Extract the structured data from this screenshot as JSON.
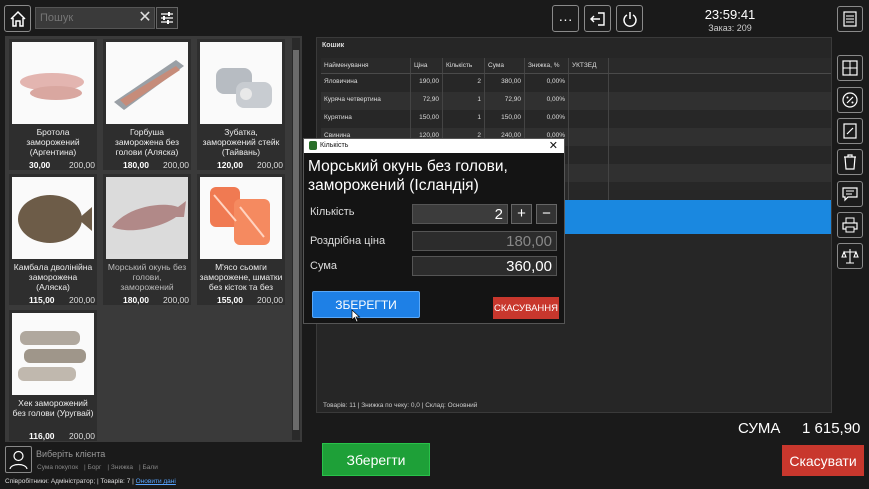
{
  "search": {
    "placeholder": "Пошук"
  },
  "header": {
    "time": "23:59:41",
    "order": "Заказ: 209"
  },
  "products": [
    {
      "name": "Бротола заморожений (Аргентина)",
      "price": "30,00",
      "stock": "200,00"
    },
    {
      "name": "Горбуша заморожена без голови (Аляска)",
      "price": "180,00",
      "stock": "200,00"
    },
    {
      "name": "Зубатка, заморожений стейк (Тайвань)",
      "price": "120,00",
      "stock": "200,00"
    },
    {
      "name": "Камбала дволінійна заморожена (Аляска)",
      "price": "115,00",
      "stock": "200,00"
    },
    {
      "name": "Морський окунь без голови, заморожений",
      "price": "180,00",
      "stock": "200,00"
    },
    {
      "name": "М'ясо сьомги заморожене, шматки без кісток та без",
      "price": "155,00",
      "stock": "200,00"
    },
    {
      "name": "Хек заморожений без голови (Уругвай)",
      "price": "116,00",
      "stock": "200,00"
    }
  ],
  "cart": {
    "title": "Кошик",
    "columns": [
      "Найменування",
      "Ціна",
      "Кількість",
      "Сума",
      "Знижка, %",
      "УКТЗЕД"
    ],
    "rows": [
      [
        "Яловичина",
        "190,00",
        "2",
        "380,00",
        "0,00%",
        ""
      ],
      [
        "Куряча четвертина",
        "72,90",
        "1",
        "72,90",
        "0,00%",
        ""
      ],
      [
        "Курятина",
        "150,00",
        "1",
        "150,00",
        "0,00%",
        ""
      ],
      [
        "Свинина",
        "120,00",
        "2",
        "240,00",
        "0,00%",
        ""
      ]
    ],
    "footer": "Товарів: 11 | Знижка по чеку: 0,0 | Склад: Основний"
  },
  "totals": {
    "label": "СУМА",
    "value": "1 615,90"
  },
  "buttons": {
    "save": "Зберегти",
    "cancel": "Скасувати"
  },
  "client": {
    "label": "Виберіть клієнта",
    "stats": [
      "Сума покупок",
      "Борг",
      "Знижка",
      "Бали"
    ]
  },
  "status": {
    "employees_label": "Співробітники:",
    "employee": "Адміністратор;",
    "goods_label": "Товарів:",
    "goods": "7",
    "refresh": "Оновити дані"
  },
  "dialog": {
    "title": "Кількість",
    "product": "Морський окунь без голови, заморожений (Ісландія)",
    "qty_label": "Кількість",
    "qty": "2",
    "price_label": "Роздрібна ціна",
    "price": "180,00",
    "sum_label": "Сума",
    "sum": "360,00",
    "save": "ЗБЕРЕГТИ",
    "cancel": "СКАСУВАННЯ"
  },
  "colors": {
    "green": "#1ea038",
    "red": "#c8372d",
    "blue": "#1e80e6",
    "selection": "#1a88e0"
  }
}
